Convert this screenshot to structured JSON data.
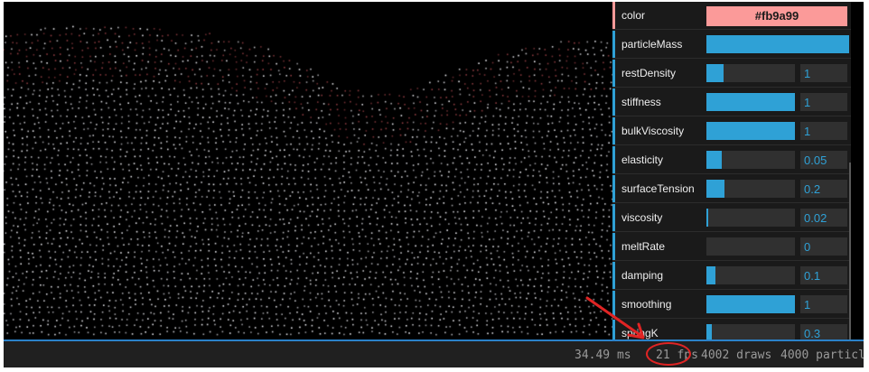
{
  "gui": {
    "color": {
      "label": "color",
      "value": "#fb9a99"
    },
    "params": [
      {
        "label": "particleMass",
        "fill": 1.0,
        "value": ""
      },
      {
        "label": "restDensity",
        "fill": 0.19,
        "value": "1"
      },
      {
        "label": "stiffness",
        "fill": 1.0,
        "value": "1"
      },
      {
        "label": "bulkViscosity",
        "fill": 1.0,
        "value": "1"
      },
      {
        "label": "elasticity",
        "fill": 0.17,
        "value": "0.05"
      },
      {
        "label": "surfaceTension",
        "fill": 0.2,
        "value": "0.2"
      },
      {
        "label": "viscosity",
        "fill": 0.02,
        "value": "0.02"
      },
      {
        "label": "meltRate",
        "fill": 0.0,
        "value": "0"
      },
      {
        "label": "damping",
        "fill": 0.1,
        "value": "0.1"
      },
      {
        "label": "smoothing",
        "fill": 1.0,
        "value": "1"
      },
      {
        "label": "springK",
        "fill": 0.06,
        "value": "0.3"
      }
    ]
  },
  "stats": {
    "ms_value": "34.49",
    "ms_unit": "ms",
    "fps_value": "21",
    "fps_unit": "fps",
    "draws_value": "4002",
    "draws_unit": "draws",
    "particles_value": "4000",
    "particles_unit": "particles"
  },
  "colors": {
    "accent": "#2fa1d6",
    "particle_pink": "#fb9a99",
    "annotation_red": "#e02424"
  }
}
